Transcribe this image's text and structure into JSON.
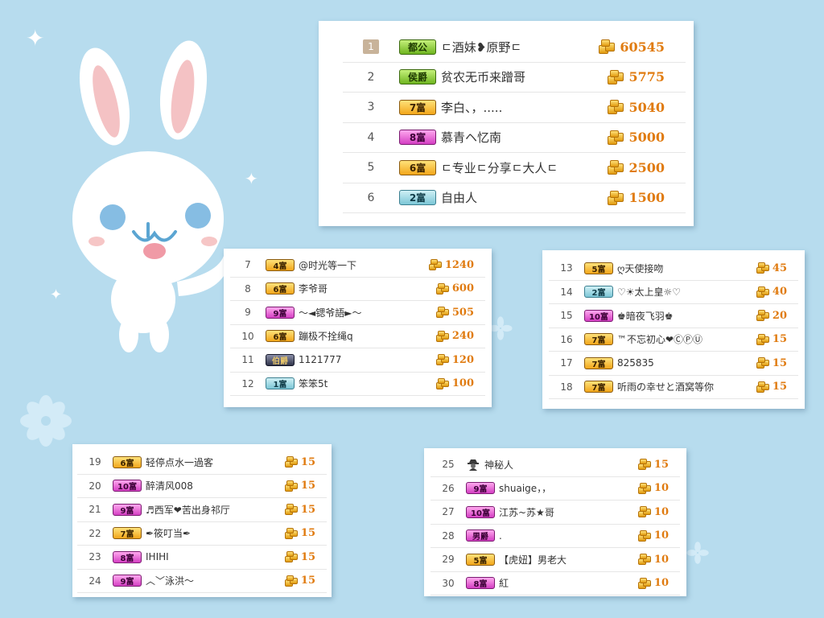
{
  "panels": [
    {
      "id": "top",
      "rows": [
        {
          "rank": "1",
          "badge": "都公",
          "badge_color": "green",
          "name": "ㄷ酒妹❥原野ㄷ",
          "amount": "60545"
        },
        {
          "rank": "2",
          "badge": "侯爵",
          "badge_color": "green",
          "name": "贫农无币来蹭哥",
          "amount": "5775"
        },
        {
          "rank": "3",
          "badge": "7富",
          "badge_color": "gold",
          "name": "李白、，.....",
          "amount": "5040"
        },
        {
          "rank": "4",
          "badge": "8富",
          "badge_color": "pink",
          "name": "慕青ヘ忆南",
          "amount": "5000"
        },
        {
          "rank": "5",
          "badge": "6富",
          "badge_color": "gold",
          "name": "ㄷ专业ㄷ分享ㄷ大人ㄷ",
          "amount": "2500"
        },
        {
          "rank": "6",
          "badge": "2富",
          "badge_color": "teal",
          "name": "自由人",
          "amount": "1500"
        }
      ]
    },
    {
      "id": "left-mid",
      "rows": [
        {
          "rank": "7",
          "badge": "4富",
          "badge_color": "gold",
          "name": "@时光等一下",
          "amount": "1240"
        },
        {
          "rank": "8",
          "badge": "6富",
          "badge_color": "gold",
          "name": "李爷哥",
          "amount": "600"
        },
        {
          "rank": "9",
          "badge": "9富",
          "badge_color": "pink",
          "name": "～◄锶爷語►～",
          "amount": "505"
        },
        {
          "rank": "10",
          "badge": "6富",
          "badge_color": "gold",
          "name": "蹦极不拴绳q",
          "amount": "240"
        },
        {
          "rank": "11",
          "badge": "伯爵",
          "badge_color": "gray",
          "name": "1121777",
          "amount": "120"
        },
        {
          "rank": "12",
          "badge": "1富",
          "badge_color": "teal",
          "name": "笨笨5t",
          "amount": "100"
        }
      ]
    },
    {
      "id": "right-mid",
      "rows": [
        {
          "rank": "13",
          "badge": "5富",
          "badge_color": "gold",
          "name": "ღ天使接吻",
          "amount": "45"
        },
        {
          "rank": "14",
          "badge": "2富",
          "badge_color": "teal",
          "name": "♡☀太上皇☼♡",
          "amount": "40"
        },
        {
          "rank": "15",
          "badge": "10富",
          "badge_color": "pink",
          "name": "♚暗夜飞羽♚",
          "amount": "20"
        },
        {
          "rank": "16",
          "badge": "7富",
          "badge_color": "gold",
          "name": "™不忘初心❤ⒸⓅⓊ",
          "amount": "15"
        },
        {
          "rank": "17",
          "badge": "7富",
          "badge_color": "gold",
          "name": "825835",
          "amount": "15"
        },
        {
          "rank": "18",
          "badge": "7富",
          "badge_color": "gold",
          "name": "听雨の幸せと酒窝等你",
          "amount": "15"
        }
      ]
    },
    {
      "id": "left-bottom",
      "rows": [
        {
          "rank": "19",
          "badge": "6富",
          "badge_color": "gold",
          "name": "轻停点水一過客",
          "amount": "15"
        },
        {
          "rank": "20",
          "badge": "10富",
          "badge_color": "pink",
          "name": "醉清风008",
          "amount": "15"
        },
        {
          "rank": "21",
          "badge": "9富",
          "badge_color": "pink",
          "name": "♬西军❤苦出身祁厅",
          "amount": "15"
        },
        {
          "rank": "22",
          "badge": "7富",
          "badge_color": "gold",
          "name": "✒筱叮当✒",
          "amount": "15"
        },
        {
          "rank": "23",
          "badge": "8富",
          "badge_color": "pink",
          "name": "IHIHI",
          "amount": "15"
        },
        {
          "rank": "24",
          "badge": "9富",
          "badge_color": "pink",
          "name": "︿﹀泳洪～",
          "amount": "15"
        }
      ]
    },
    {
      "id": "right-bottom",
      "rows": [
        {
          "rank": "25",
          "badge": "",
          "badge_color": "icon",
          "name": "神秘人",
          "amount": "15"
        },
        {
          "rank": "26",
          "badge": "9富",
          "badge_color": "pink",
          "name": "shuaige，，",
          "amount": "10"
        },
        {
          "rank": "27",
          "badge": "10富",
          "badge_color": "pink",
          "name": "江苏~苏★哥",
          "amount": "10"
        },
        {
          "rank": "28",
          "badge": "男爵",
          "badge_color": "pink",
          "name": ".",
          "amount": "10"
        },
        {
          "rank": "29",
          "badge": "5富",
          "badge_color": "gold",
          "name": "【虎妞】男老大",
          "amount": "10"
        },
        {
          "rank": "30",
          "badge": "8富",
          "badge_color": "pink",
          "name": "紅",
          "amount": "10"
        }
      ]
    }
  ],
  "colors": {
    "background": "#b7dcee",
    "amount": "#e07b10"
  },
  "icons": {
    "coin": "gold-coin-stack-icon",
    "mystery": "mystery-person-icon"
  }
}
